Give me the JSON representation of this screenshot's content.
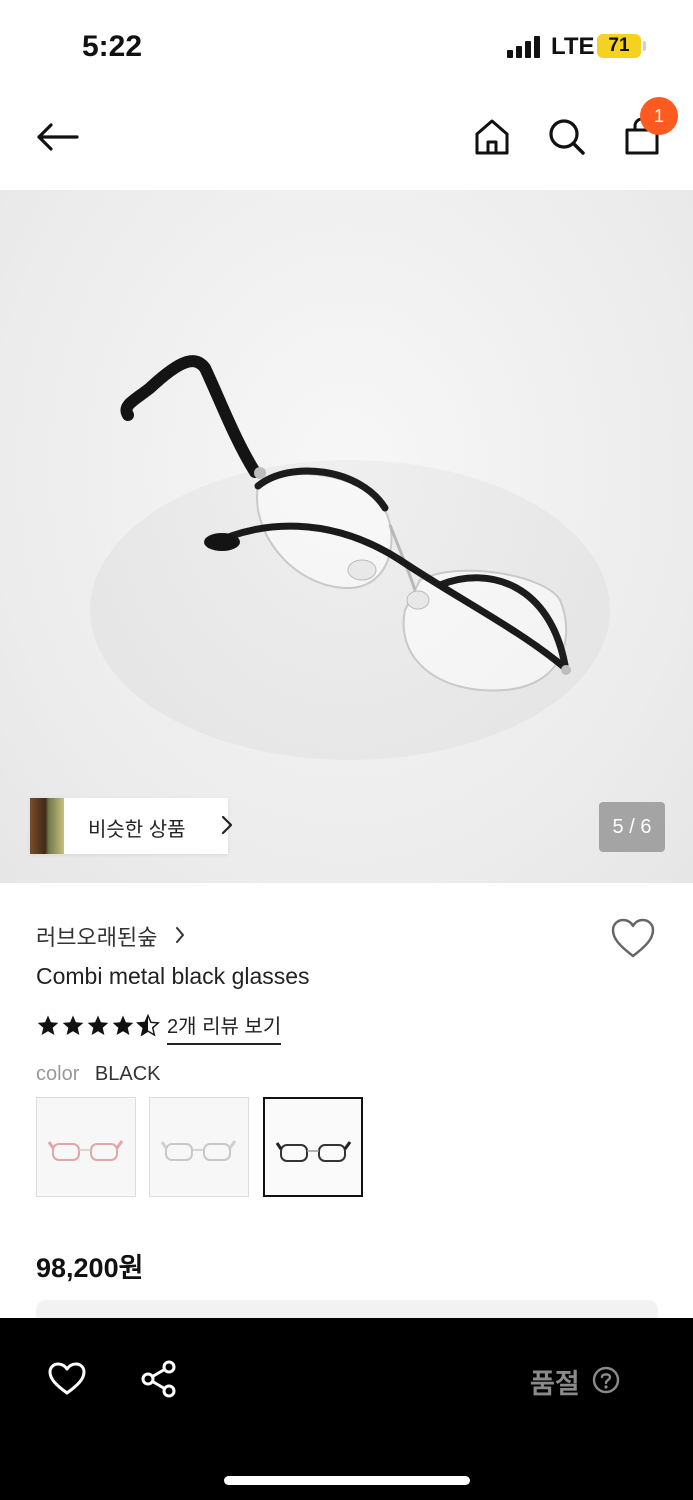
{
  "status_bar": {
    "time": "5:22",
    "network": "LTE",
    "battery": "71"
  },
  "header": {
    "cart_count": "1"
  },
  "hero": {
    "page_counter": "5 / 6",
    "similar_label": "비슷한 상품"
  },
  "product": {
    "brand": "러브오래된숲",
    "name": "Combi metal black glasses",
    "rating": 4.5,
    "reviews_link": "2개 리뷰 보기",
    "color_label": "color",
    "color_value": "BLACK",
    "price": "98,200원"
  },
  "swatches": [
    {
      "name": "pink",
      "accent": "#e8a3a3"
    },
    {
      "name": "silver",
      "accent": "#c8c8c8"
    },
    {
      "name": "black",
      "accent": "#222222",
      "selected": true
    }
  ],
  "bottom_bar": {
    "status": "품절"
  },
  "colors": {
    "badge": "#ff5a1f",
    "star": "#111111",
    "bottom_bar": "#000000"
  }
}
